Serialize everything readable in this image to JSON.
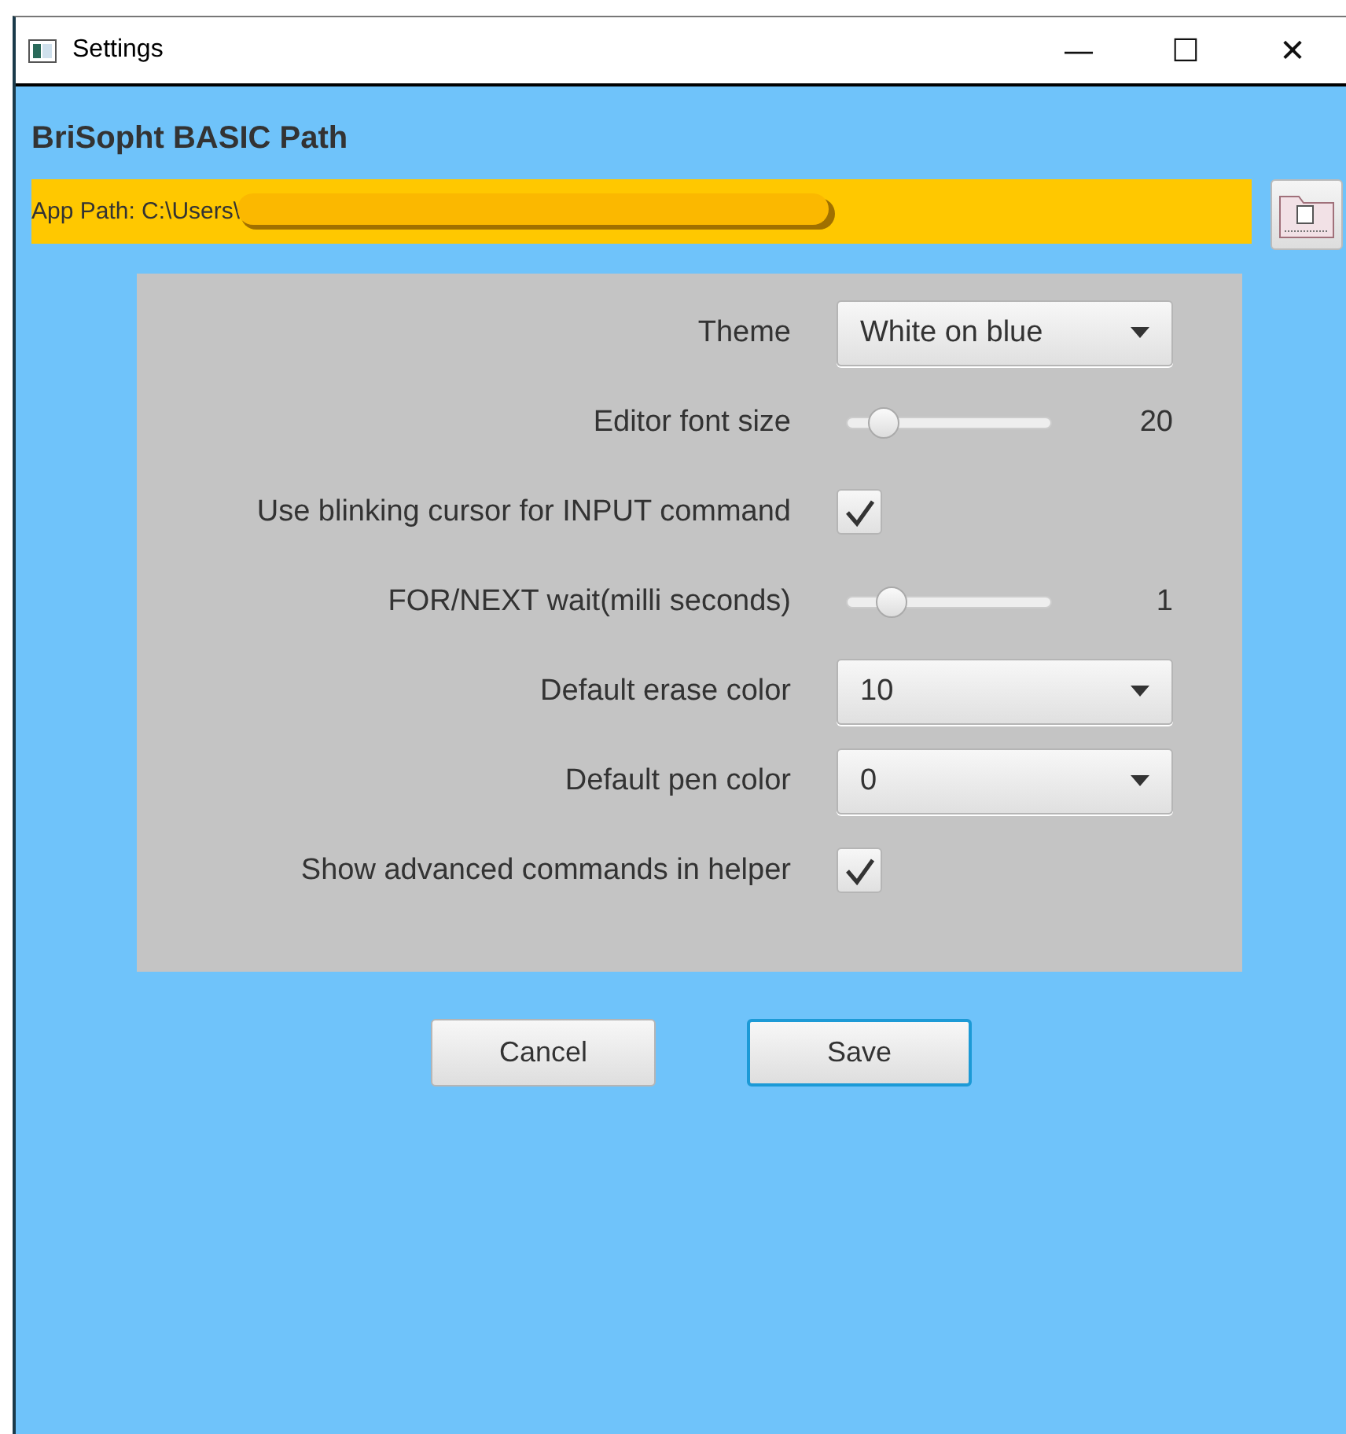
{
  "window": {
    "title": "Settings",
    "controls": [
      "—",
      "☐",
      "✕"
    ]
  },
  "heading": "BriSopht BASIC Path",
  "app_path": {
    "label": "App Path: C:\\Users\\"
  },
  "settings": [
    {
      "kind": "select",
      "label": "Theme",
      "value": "White on blue"
    },
    {
      "kind": "slider",
      "label": "Editor font size",
      "level": 0.18,
      "reading": "20"
    },
    {
      "kind": "checkbox",
      "label": "Use blinking cursor for INPUT command",
      "checked": true
    },
    {
      "kind": "slider",
      "label": "FOR/NEXT wait(milli seconds)",
      "level": 0.22,
      "reading": "1"
    },
    {
      "kind": "select",
      "label": "Default erase color",
      "value": "10"
    },
    {
      "kind": "select",
      "label": "Default pen color",
      "value": "0"
    },
    {
      "kind": "checkbox",
      "label": "Show advanced commands in helper",
      "checked": true
    }
  ],
  "buttons": [
    {
      "label": "Cancel",
      "default": false
    },
    {
      "label": "Save",
      "default": true
    }
  ]
}
